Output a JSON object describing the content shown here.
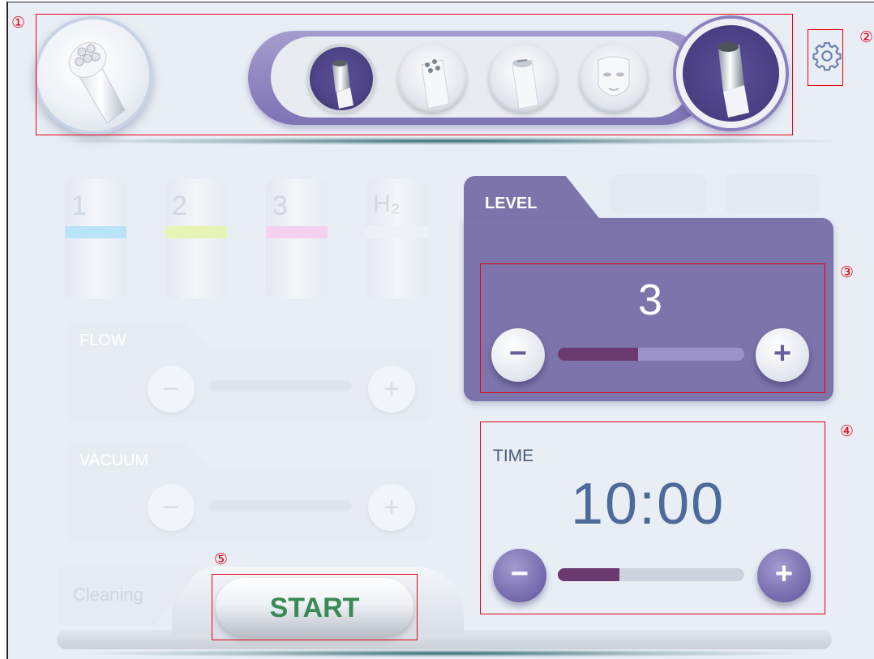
{
  "annotations": {
    "n1": "①",
    "n2": "②",
    "n3": "③",
    "n4": "④",
    "n5": "⑤"
  },
  "handpieces": {
    "current": "crystal-dome-handpiece",
    "slots": [
      {
        "icon": "aqua-peel-tip-icon",
        "active": true
      },
      {
        "icon": "multi-ball-roller-icon",
        "active": false
      },
      {
        "icon": "ultrasonic-probe-icon",
        "active": false
      },
      {
        "icon": "face-mask-icon",
        "active": false
      }
    ],
    "selected": "aqua-peel-tip-icon"
  },
  "settings_icon": "gear-icon",
  "solutions": [
    {
      "label": "1",
      "color": "#b9e3f6"
    },
    {
      "label": "2",
      "color": "#e8f4b6"
    },
    {
      "label": "3",
      "color": "#f4d1ee"
    },
    {
      "label": "H₂",
      "color": "#eef1f5"
    }
  ],
  "flow": {
    "label": "FLOW",
    "minus": "−",
    "plus": "+"
  },
  "vacuum": {
    "label": "VACUUM",
    "minus": "−",
    "plus": "+"
  },
  "level": {
    "label": "LEVEL",
    "value": "3",
    "fill_fraction": 0.43,
    "minus": "−",
    "plus": "+"
  },
  "time": {
    "label": "TIME",
    "value": "10:00",
    "fill_fraction": 0.33,
    "minus": "−",
    "plus": "+"
  },
  "cleaning_label": "Cleaning",
  "start_label": "START",
  "colors": {
    "accent_purple": "#7c74ab",
    "slider_fill": "#6a3a6e",
    "start_text": "#3a8a55",
    "annotation_red": "#e60012"
  }
}
